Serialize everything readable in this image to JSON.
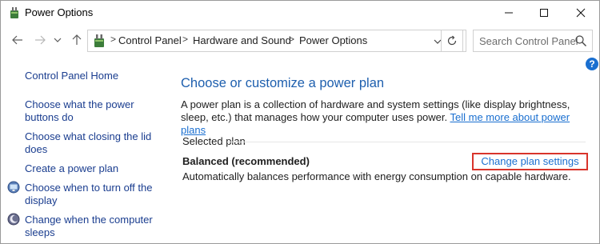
{
  "window": {
    "title": "Power Options"
  },
  "address": {
    "breadcrumbs": [
      "Control Panel",
      "Hardware and Sound",
      "Power Options"
    ],
    "separator": ">"
  },
  "search": {
    "placeholder": "Search Control Panel"
  },
  "help_label": "?",
  "sidebar": {
    "items": [
      {
        "label": "Control Panel Home"
      },
      {
        "label": "Choose what the power buttons do"
      },
      {
        "label": "Choose what closing the lid does"
      },
      {
        "label": "Create a power plan"
      },
      {
        "label": "Choose when to turn off the display",
        "icon": "monitor-icon"
      },
      {
        "label": "Change when the computer sleeps",
        "icon": "moon-icon"
      }
    ]
  },
  "main": {
    "heading": "Choose or customize a power plan",
    "description": "A power plan is a collection of hardware and system settings (like display brightness, sleep, etc.) that manages how your computer uses power.",
    "learn_more_link": "Tell me more about power plans",
    "section_label": "Selected plan",
    "plan": {
      "name": "Balanced (recommended)",
      "description": "Automatically balances performance with energy consumption on capable hardware.",
      "change_link": "Change plan settings"
    }
  },
  "colors": {
    "link": "#1a6fd0",
    "heading": "#1e5fae",
    "highlight_box": "#d9342b"
  }
}
